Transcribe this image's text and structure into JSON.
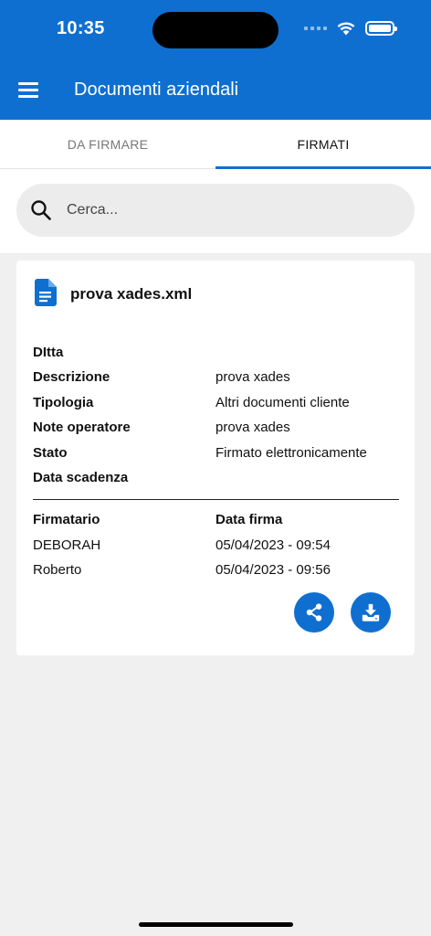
{
  "status_bar": {
    "time": "10:35"
  },
  "header": {
    "title": "Documenti aziendali",
    "menu_icon": "hamburger-menu-icon"
  },
  "tabs": [
    {
      "label": "DA FIRMARE",
      "active": false
    },
    {
      "label": "FIRMATI",
      "active": true
    }
  ],
  "search": {
    "placeholder": "Cerca...",
    "value": ""
  },
  "document": {
    "name": "prova xades.xml",
    "icon": "document-icon",
    "fields": [
      {
        "label": "DItta",
        "value": ""
      },
      {
        "label": "Descrizione",
        "value": "prova xades"
      },
      {
        "label": "Tipologia",
        "value": "Altri documenti cliente"
      },
      {
        "label": "Note operatore",
        "value": "prova xades"
      },
      {
        "label": "Stato",
        "value": "Firmato elettronicamente"
      },
      {
        "label": "Data scadenza",
        "value": ""
      }
    ],
    "signers_header": {
      "col1": "Firmatario",
      "col2": "Data firma"
    },
    "signers": [
      {
        "name": "DEBORAH",
        "date": "05/04/2023 - 09:54"
      },
      {
        "name": "Roberto",
        "date": "05/04/2023 - 09:56"
      }
    ],
    "actions": {
      "share_icon": "share-icon",
      "download_icon": "download-icon"
    }
  },
  "colors": {
    "primary": "#0f6fd0",
    "background": "#f0f0f0"
  }
}
